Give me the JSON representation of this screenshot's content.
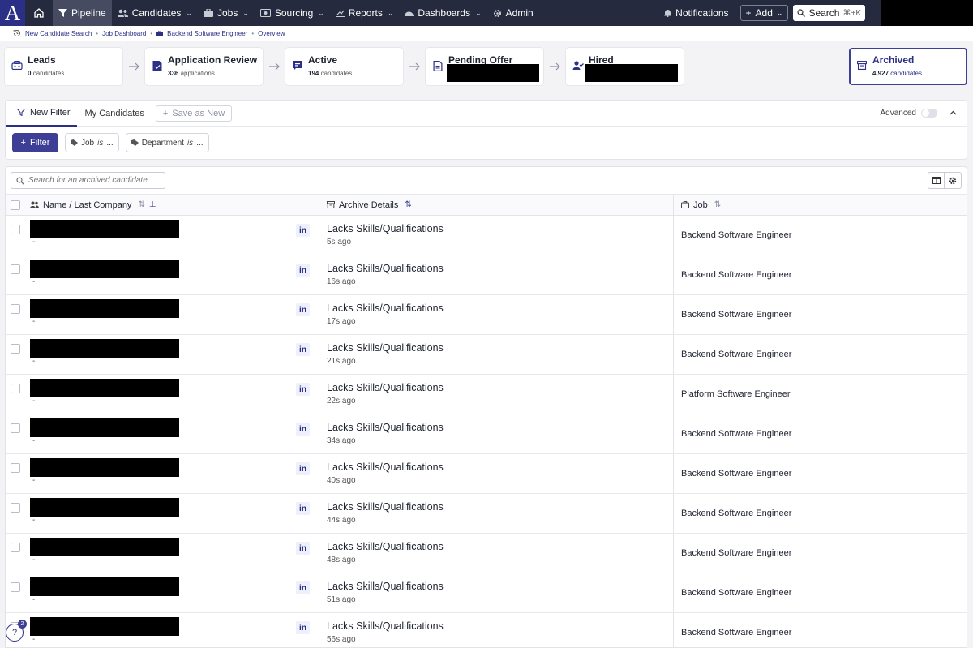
{
  "nav": {
    "logo": "A",
    "items": [
      {
        "label": "Pipeline",
        "icon": "filter-icon"
      },
      {
        "label": "Candidates",
        "icon": "people-icon"
      },
      {
        "label": "Jobs",
        "icon": "briefcase-icon"
      },
      {
        "label": "Sourcing",
        "icon": "sourcing-icon"
      },
      {
        "label": "Reports",
        "icon": "chart-icon"
      },
      {
        "label": "Dashboards",
        "icon": "dashboard-icon"
      },
      {
        "label": "Admin",
        "icon": "gear-icon"
      }
    ],
    "notifications": "Notifications",
    "add": "Add",
    "search": "Search",
    "search_shortcut": "⌘+K"
  },
  "breadcrumbs": [
    "New Candidate Search",
    "Job Dashboard",
    "Backend Software Engineer",
    "Overview"
  ],
  "stages": [
    {
      "title": "Leads",
      "count": "0",
      "unit": "candidates"
    },
    {
      "title": "Application Review",
      "count": "336",
      "unit": "applications"
    },
    {
      "title": "Active",
      "count": "194",
      "unit": "candidates"
    },
    {
      "title": "Pending Offer"
    },
    {
      "title": "Hired"
    }
  ],
  "archived": {
    "title": "Archived",
    "count": "4,927",
    "unit": "candidates"
  },
  "filters": {
    "tabs": [
      "New Filter",
      "My Candidates"
    ],
    "save_as_new": "Save as New",
    "advanced": "Advanced",
    "filter_button": "Filter",
    "chips": [
      {
        "field": "Job",
        "op": "is",
        "value": "..."
      },
      {
        "field": "Department",
        "op": "is",
        "value": "..."
      }
    ]
  },
  "table": {
    "search_placeholder": "Search for an archived candidate",
    "columns": [
      "Name / Last Company",
      "Archive Details",
      "Job"
    ],
    "rows": [
      {
        "last_company": "-",
        "reason": "Lacks Skills/Qualifications",
        "ago": "5s ago",
        "job": "Backend Software Engineer"
      },
      {
        "last_company": "-",
        "reason": "Lacks Skills/Qualifications",
        "ago": "16s ago",
        "job": "Backend Software Engineer"
      },
      {
        "last_company": "-",
        "reason": "Lacks Skills/Qualifications",
        "ago": "17s ago",
        "job": "Backend Software Engineer"
      },
      {
        "last_company": "-",
        "reason": "Lacks Skills/Qualifications",
        "ago": "21s ago",
        "job": "Backend Software Engineer"
      },
      {
        "last_company": "-",
        "reason": "Lacks Skills/Qualifications",
        "ago": "22s ago",
        "job": "Platform Software Engineer"
      },
      {
        "last_company": "-",
        "reason": "Lacks Skills/Qualifications",
        "ago": "34s ago",
        "job": "Backend Software Engineer"
      },
      {
        "last_company": "-",
        "reason": "Lacks Skills/Qualifications",
        "ago": "40s ago",
        "job": "Backend Software Engineer"
      },
      {
        "last_company": "-",
        "reason": "Lacks Skills/Qualifications",
        "ago": "44s ago",
        "job": "Backend Software Engineer"
      },
      {
        "last_company": "-",
        "reason": "Lacks Skills/Qualifications",
        "ago": "48s ago",
        "job": "Backend Software Engineer"
      },
      {
        "last_company": "-",
        "reason": "Lacks Skills/Qualifications",
        "ago": "51s ago",
        "job": "Backend Software Engineer"
      },
      {
        "last_company": "-",
        "reason": "Lacks Skills/Qualifications",
        "ago": "56s ago",
        "job": "Backend Software Engineer"
      }
    ]
  },
  "help": {
    "label": "?",
    "badge": "2"
  },
  "colors": {
    "brand": "#2b2f86",
    "nav_bg": "#262a3e",
    "accent": "#3c3f95"
  }
}
